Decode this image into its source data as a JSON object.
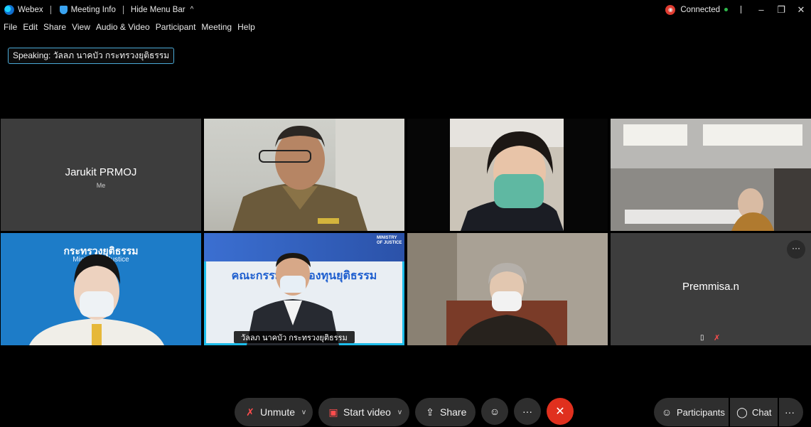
{
  "titlebar": {
    "app_name": "Webex",
    "meeting_info": "Meeting Info",
    "hide_menu": "Hide Menu Bar",
    "status": "Connected"
  },
  "menu": [
    "File",
    "Edit",
    "Share",
    "View",
    "Audio & Video",
    "Participant",
    "Meeting",
    "Help"
  ],
  "speaking": "Speaking: วัลลภ นาคบัว กระทรวงยุติธรรม",
  "tiles": {
    "self_name": "Jarukit PRMOJ",
    "self_tag": "Me",
    "active_speaker": "วัลลภ นาคบัว กระทรวงยุติธรรม",
    "banner_heading": "คณะกรรมการกองทุนยุติธรรม",
    "ministry_label": "MINISTRY OF JUSTICE",
    "backdrop_heading": "กระทรวงยุติธรรม",
    "backdrop_sub": "Ministry of Justice",
    "premmisa_name": "Premmisa.n"
  },
  "controls": {
    "unmute": "Unmute",
    "start_video": "Start video",
    "share": "Share",
    "participants": "Participants",
    "chat": "Chat"
  },
  "colors": {
    "accent": "#1ebdeb",
    "leave": "#e0301e",
    "connected": "#2fb84b",
    "mute_red": "#ff4d4d"
  }
}
